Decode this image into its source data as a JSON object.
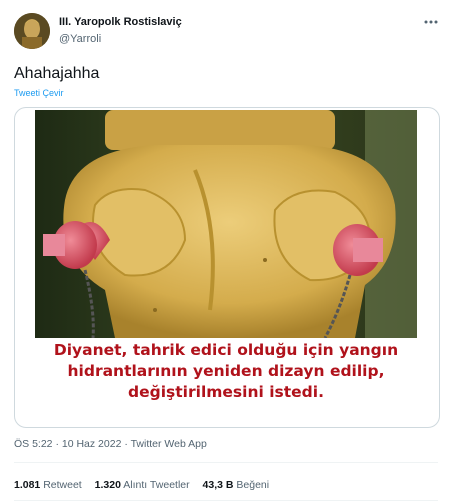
{
  "author": {
    "display_name": "III. Yaropolk Rostislaviç",
    "handle": "@Yarroli"
  },
  "tweet": {
    "text": "Ahahajahha",
    "translate_label": "Tweeti Çevir"
  },
  "media": {
    "caption_lines": [
      "Diyanet, tahrik edici olduğu için yangın",
      "hidrantlarının yeniden dizayn edilip,",
      "değiştirilmesini istedi."
    ],
    "caption_color": "#b0121b"
  },
  "meta": {
    "time": "ÖS 5:22",
    "date": "10 Haz 2022",
    "source": "Twitter Web App",
    "separator": " · "
  },
  "stats": {
    "retweets_value": "1.081",
    "retweets_label": "Retweet",
    "quotes_value": "1.320",
    "quotes_label": "Alıntı Tweetler",
    "likes_value": "43,3 B",
    "likes_label": "Beğeni"
  },
  "colors": {
    "link": "#1d9bf0",
    "secondary_text": "#536471",
    "hydrant_yellow": "#d9b24a",
    "cap_red": "#d8475a"
  }
}
